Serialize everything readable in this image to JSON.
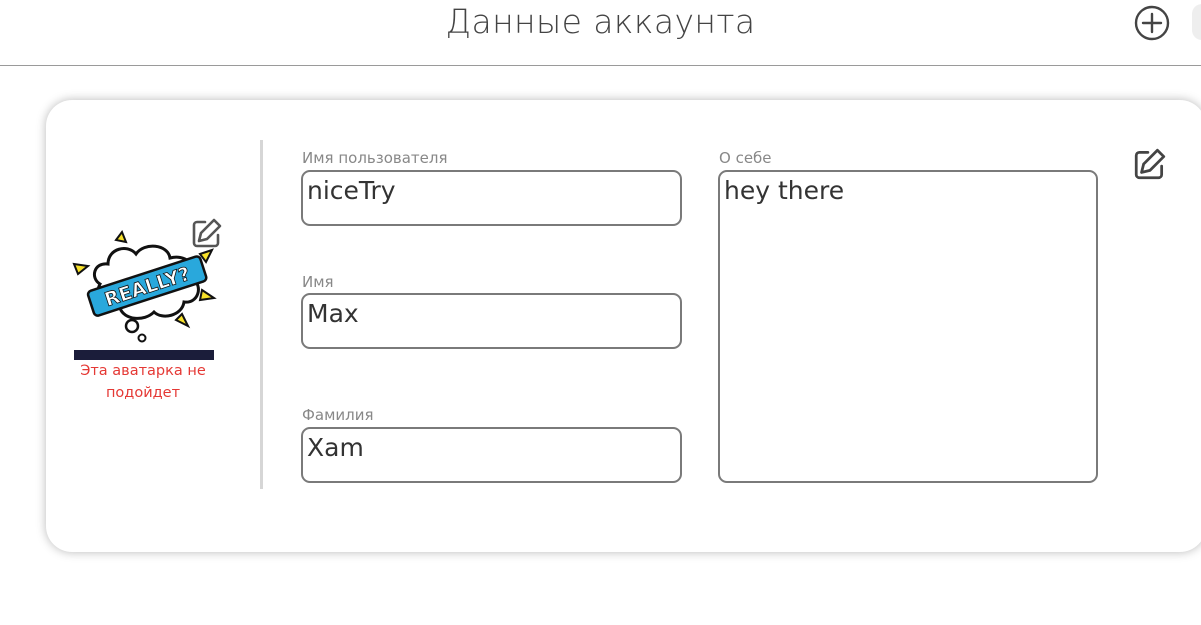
{
  "header": {
    "title": "Данные аккаунта",
    "add_icon": "plus-circle-icon"
  },
  "profile": {
    "avatar": {
      "image_text": "REALLY?",
      "edit_icon": "pencil-square-icon",
      "error_text": "Эта аватарка не подойдет"
    },
    "fields": {
      "username": {
        "label": "Имя пользователя",
        "value": "niceTry"
      },
      "first_name": {
        "label": "Имя",
        "value": "Max"
      },
      "last_name": {
        "label": "Фамилия",
        "value": "Xam"
      },
      "about": {
        "label": "О себе",
        "value": "hey there"
      }
    },
    "edit_icon": "pencil-square-icon"
  },
  "colors": {
    "error": "#e53935",
    "border": "#7a7a7a",
    "label": "#888888",
    "avatar_blue": "#29a8dc",
    "avatar_yellow": "#f7e12a"
  }
}
